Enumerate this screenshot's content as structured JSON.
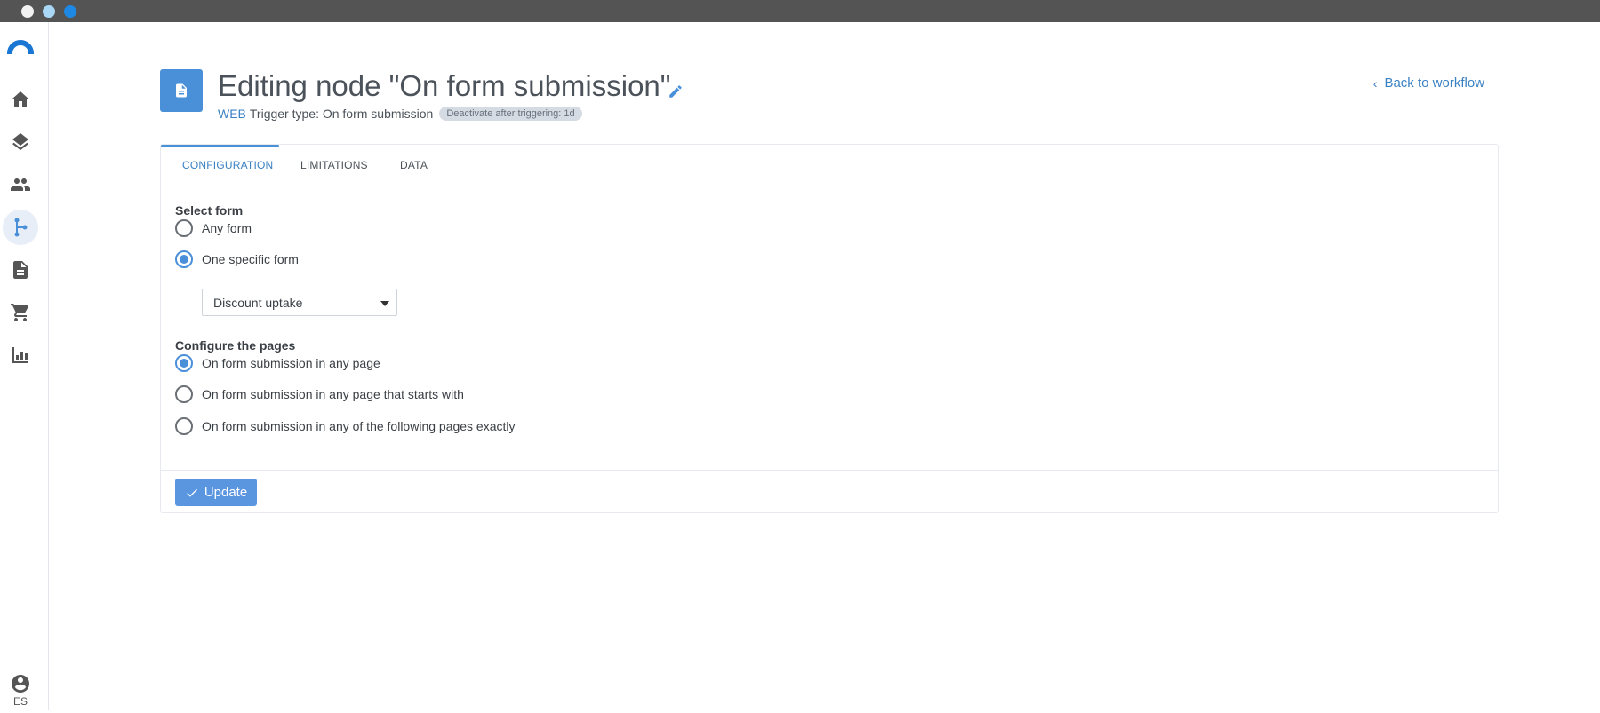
{
  "window": {
    "controls": [
      "close",
      "minimize",
      "maximize"
    ]
  },
  "sidebar": {
    "logo": "brand-logo",
    "items": [
      {
        "icon": "home-icon"
      },
      {
        "icon": "layers-icon"
      },
      {
        "icon": "people-icon"
      },
      {
        "icon": "workflow-icon",
        "active": true
      },
      {
        "icon": "document-icon"
      },
      {
        "icon": "cart-icon"
      },
      {
        "icon": "chart-icon"
      }
    ],
    "user": {
      "icon": "account-icon",
      "language": "ES"
    }
  },
  "header": {
    "title": "Editing node \"On form submission\"",
    "channel": "WEB",
    "trigger_type": "Trigger type: On form submission",
    "badge": "Deactivate after triggering: 1d",
    "back_link": "Back to workflow"
  },
  "tabs": [
    {
      "label": "CONFIGURATION",
      "active": true
    },
    {
      "label": "LIMITATIONS",
      "active": false
    },
    {
      "label": "DATA",
      "active": false
    }
  ],
  "form_section": {
    "label": "Select form",
    "options": [
      {
        "label": "Any form",
        "checked": false
      },
      {
        "label": "One specific form",
        "checked": true
      }
    ],
    "selected_form": "Discount uptake"
  },
  "pages_section": {
    "label": "Configure the pages",
    "options": [
      {
        "label": "On form submission in any page",
        "checked": true
      },
      {
        "label": "On form submission in any page that starts with",
        "checked": false
      },
      {
        "label": "On form submission in any of the following pages exactly",
        "checked": false
      }
    ]
  },
  "actions": {
    "update_label": "Update"
  },
  "colors": {
    "accent": "#4a90d9",
    "link": "#3b82c4",
    "titlebar": "#545454"
  }
}
